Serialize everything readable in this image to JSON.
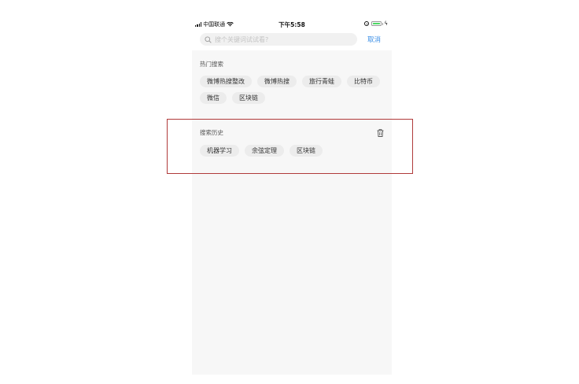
{
  "status_bar": {
    "carrier": "中国联通",
    "time": "下午5:58"
  },
  "search": {
    "placeholder": "搜个关键词试试看?",
    "value": "",
    "cancel_label": "取消"
  },
  "hot_search": {
    "title": "热门搜索",
    "tags": [
      "微博热搜整改",
      "微博热搜",
      "旅行青蛙",
      "比特币",
      "微信",
      "区块链"
    ]
  },
  "history": {
    "title": "搜索历史",
    "tags": [
      "机器学习",
      "余弦定理",
      "区块链"
    ]
  },
  "colors": {
    "accent": "#3a8ee6",
    "highlight_border": "#b03a3a",
    "tag_bg": "#ececec",
    "page_bg": "#f7f7f7"
  }
}
